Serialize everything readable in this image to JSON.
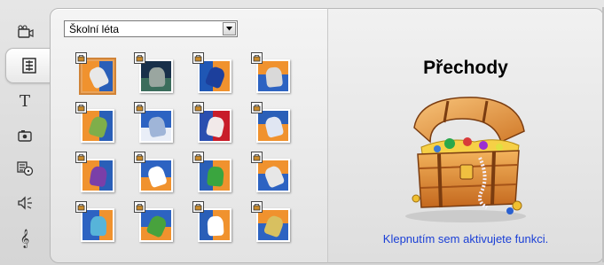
{
  "tabs": [
    {
      "name": "video-tab",
      "icon": "video-camera-icon"
    },
    {
      "name": "transitions-tab",
      "icon": "transitions-icon",
      "active": true
    },
    {
      "name": "titles-tab",
      "icon": "title-T-icon",
      "label": "T"
    },
    {
      "name": "photos-tab",
      "icon": "camera-icon"
    },
    {
      "name": "disc-menus-tab",
      "icon": "disc-menu-icon"
    },
    {
      "name": "sound-effects-tab",
      "icon": "speaker-icon"
    },
    {
      "name": "music-tab",
      "icon": "treble-clef-icon",
      "label": "𝄞"
    }
  ],
  "effects": {
    "category": "Školní léta",
    "thumbnails": [
      {
        "bg": "#f0922e",
        "fg": "#2a5fb8",
        "fig": "#e8e8e8"
      },
      {
        "bg": "#18304a",
        "fg": "#3b6d5c",
        "fig": "#9aa6a0"
      },
      {
        "bg": "#f0922e",
        "fg": "#1f57b5",
        "fig": "#1c3f9c"
      },
      {
        "bg": "#2d63c2",
        "fg": "#f0922e",
        "fig": "#d9d9d9"
      },
      {
        "bg": "#f0922e",
        "fg": "#2a5fb8",
        "fig": "#7fae4a"
      },
      {
        "bg": "#2d63c2",
        "fg": "#e9eef7",
        "fig": "#9fb5d8"
      },
      {
        "bg": "#c81d2a",
        "fg": "#2a4fb0",
        "fig": "#f1e9e9"
      },
      {
        "bg": "#f0922e",
        "fg": "#2a5fb8",
        "fig": "#e0e6f2"
      },
      {
        "bg": "#f0922e",
        "fg": "#2a5fb8",
        "fig": "#7a3fa8"
      },
      {
        "bg": "#2d63c2",
        "fg": "#f0922e",
        "fig": "#ffffff"
      },
      {
        "bg": "#f0922e",
        "fg": "#2a5fb8",
        "fig": "#3aa53f"
      },
      {
        "bg": "#2d63c2",
        "fg": "#f0922e",
        "fig": "#e7e7e7"
      },
      {
        "bg": "#2d63c2",
        "fg": "#f0922e",
        "fig": "#57b4d9"
      },
      {
        "bg": "#2d63c2",
        "fg": "#f0922e",
        "fig": "#48a23d"
      },
      {
        "bg": "#f0922e",
        "fg": "#2a5fb8",
        "fig": "#ffffff"
      },
      {
        "bg": "#2d63c2",
        "fg": "#f0922e",
        "fig": "#d8c060"
      }
    ]
  },
  "info": {
    "title": "Přechody",
    "activate_link": "Klepnutím sem aktivujete funkci."
  },
  "colors": {
    "link": "#1a3fd6",
    "selection": "#e9a35a"
  }
}
